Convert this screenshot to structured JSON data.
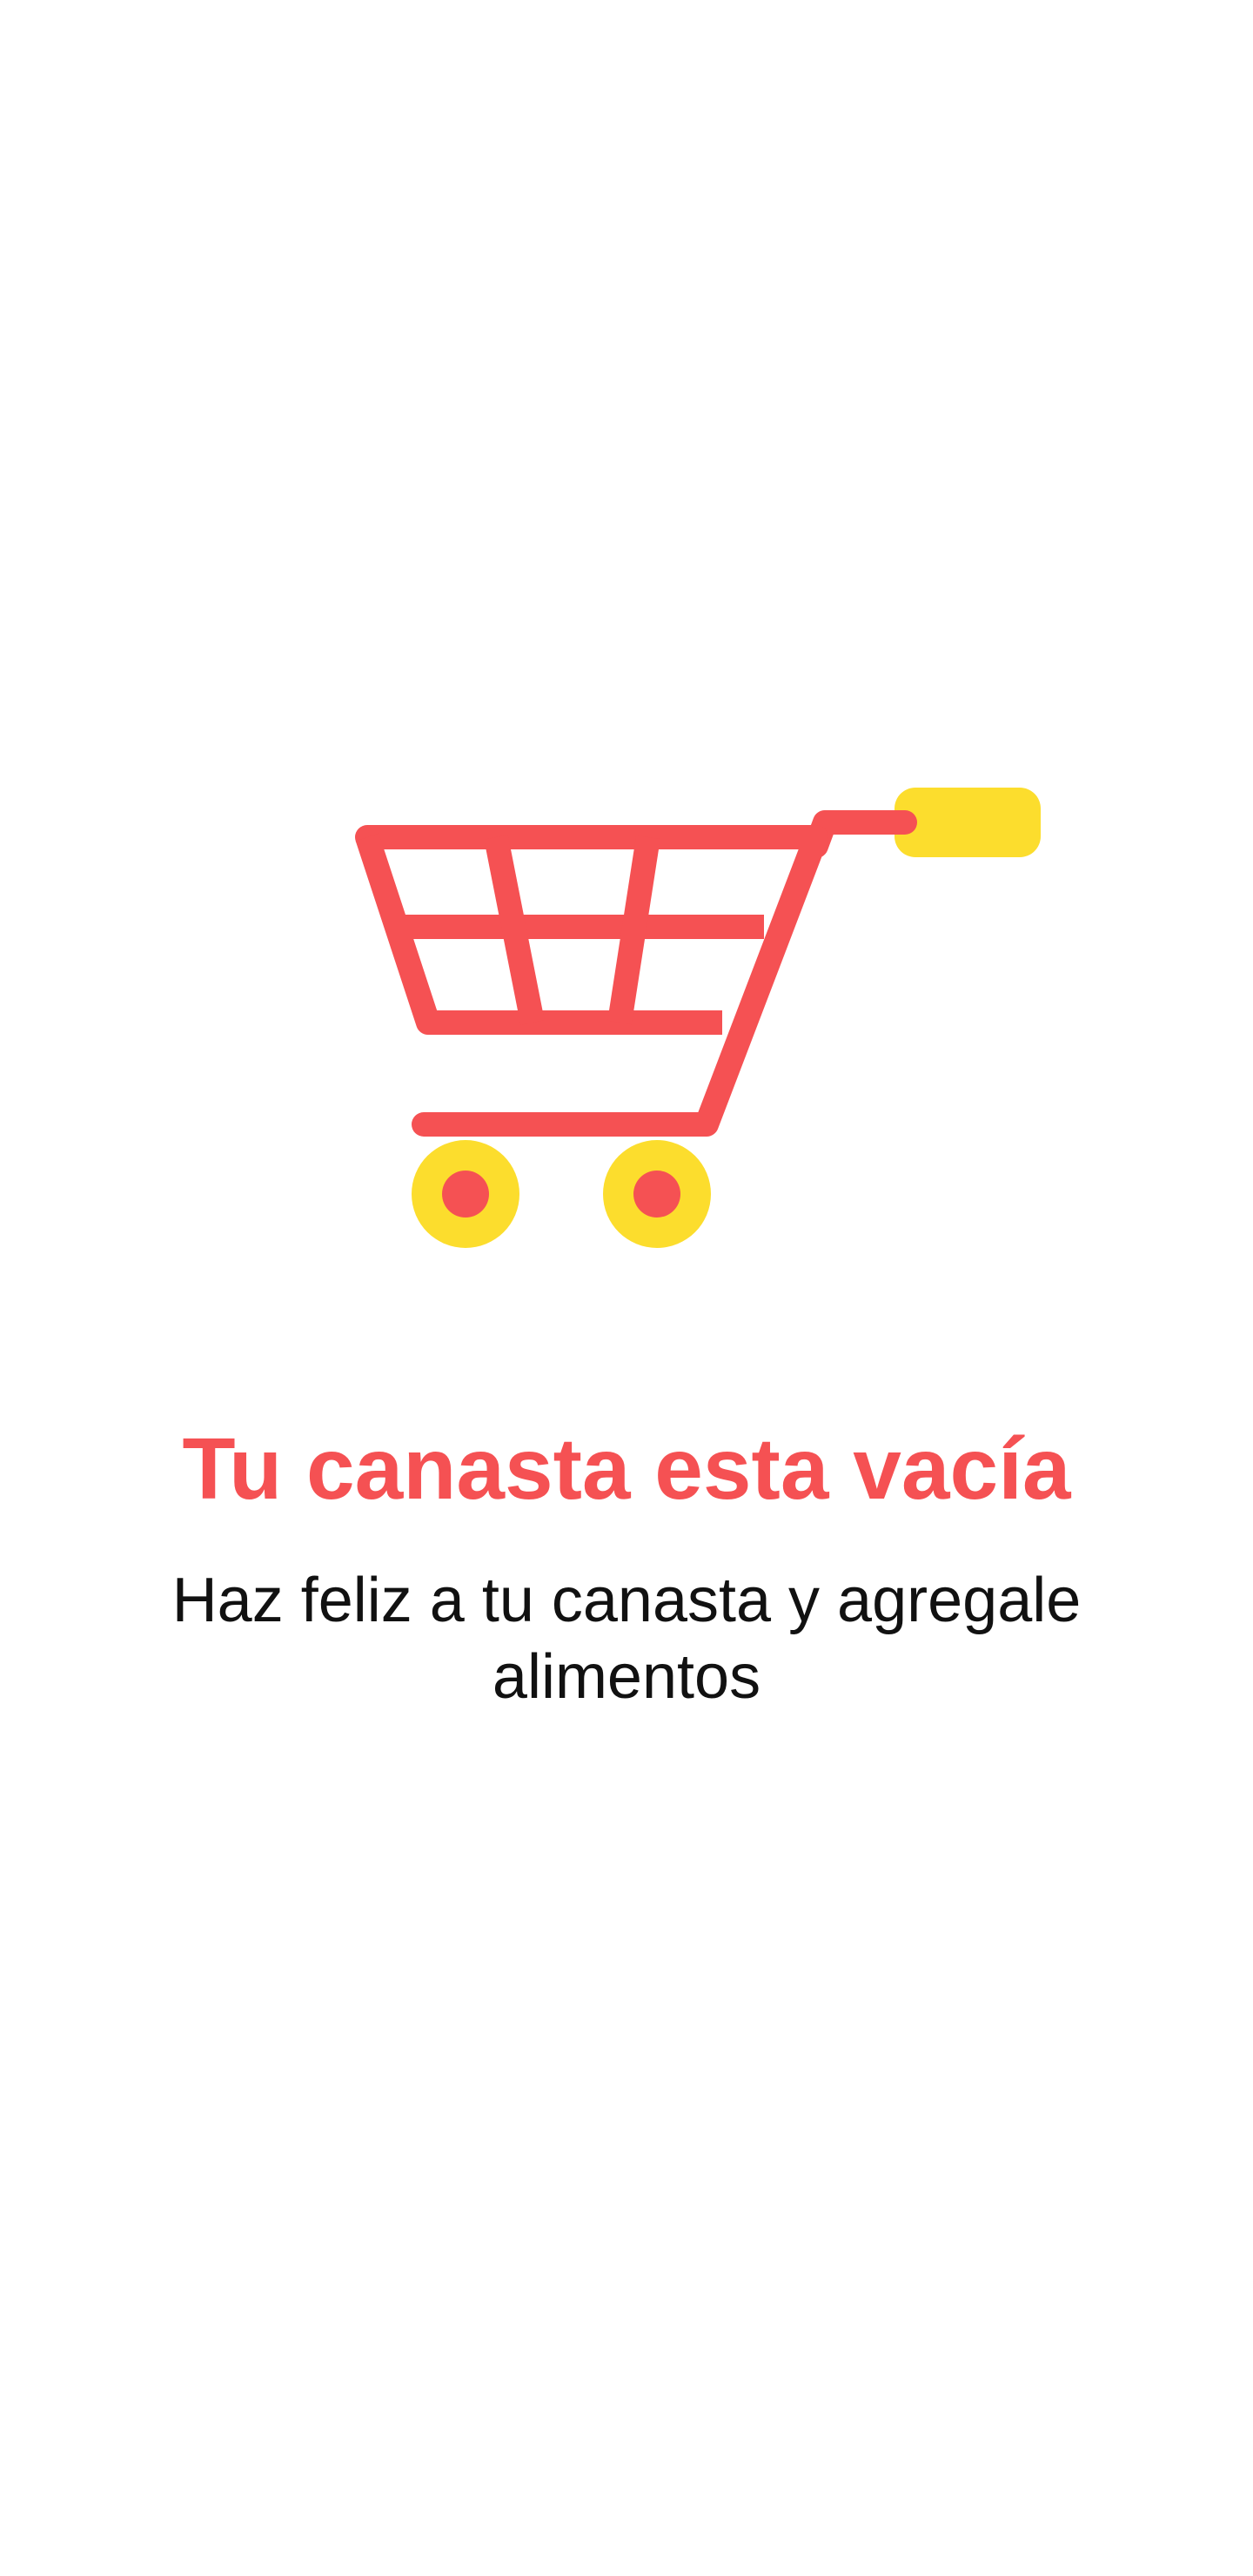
{
  "empty_state": {
    "illustration_icon": "shopping-cart-icon",
    "title": "Tu canasta esta vacía",
    "message": "Haz feliz a tu canasta y agregale alimentos"
  },
  "colors": {
    "background": "#ffffff",
    "accent_red": "#F55153",
    "accent_yellow": "#FCDD2D",
    "text_dark": "#111111"
  }
}
